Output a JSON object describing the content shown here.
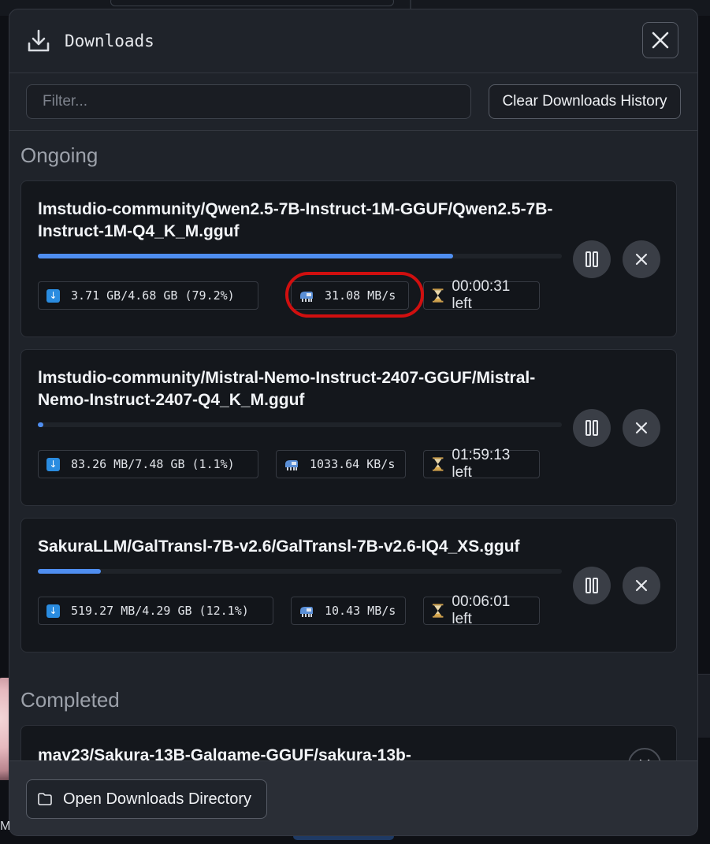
{
  "header": {
    "title": "Downloads"
  },
  "toolbar": {
    "filter_placeholder": "Filter...",
    "clear_label": "Clear Downloads History"
  },
  "sections": {
    "ongoing": "Ongoing",
    "completed": "Completed"
  },
  "ongoing": [
    {
      "name": "lmstudio-community/Qwen2.5-7B-Instruct-1M-GGUF/Qwen2.5-7B-Instruct-1M-Q4_K_M.gguf",
      "progress_percent": 79.2,
      "size_text": "3.71 GB/4.68 GB (79.2%)",
      "speed_text": "31.08 MB/s",
      "time_left_text": "00:00:31 left",
      "highlighted": "speed"
    },
    {
      "name": "lmstudio-community/Mistral-Nemo-Instruct-2407-GGUF/Mistral-Nemo-Instruct-2407-Q4_K_M.gguf",
      "progress_percent": 1.1,
      "size_text": "83.26 MB/7.48 GB (1.1%)",
      "speed_text": "1033.64 KB/s",
      "time_left_text": "01:59:13 left"
    },
    {
      "name": "SakuraLLM/GalTransl-7B-v2.6/GalTransl-7B-v2.6-IQ4_XS.gguf",
      "progress_percent": 12.1,
      "size_text": "519.27 MB/4.29 GB (12.1%)",
      "speed_text": "10.43 MB/s",
      "time_left_text": "00:06:01 left"
    }
  ],
  "completed": [
    {
      "name": "mav23/Sakura-13B-Galgame-GGUF/sakura-13b-"
    }
  ],
  "footer": {
    "open_dir_label": "Open Downloads Directory"
  },
  "icons": {
    "header": "download-icon",
    "close": "close-icon",
    "size": "download-arrow-icon",
    "speed": "speed-icon",
    "time": "hourglass-icon",
    "pause": "pause-icon",
    "cancel": "cancel-icon",
    "folder": "folder-icon"
  },
  "colors": {
    "accent": "#4f8ef0",
    "highlight": "#d00f0f",
    "panel": "#1f232a",
    "card": "#14171c"
  }
}
